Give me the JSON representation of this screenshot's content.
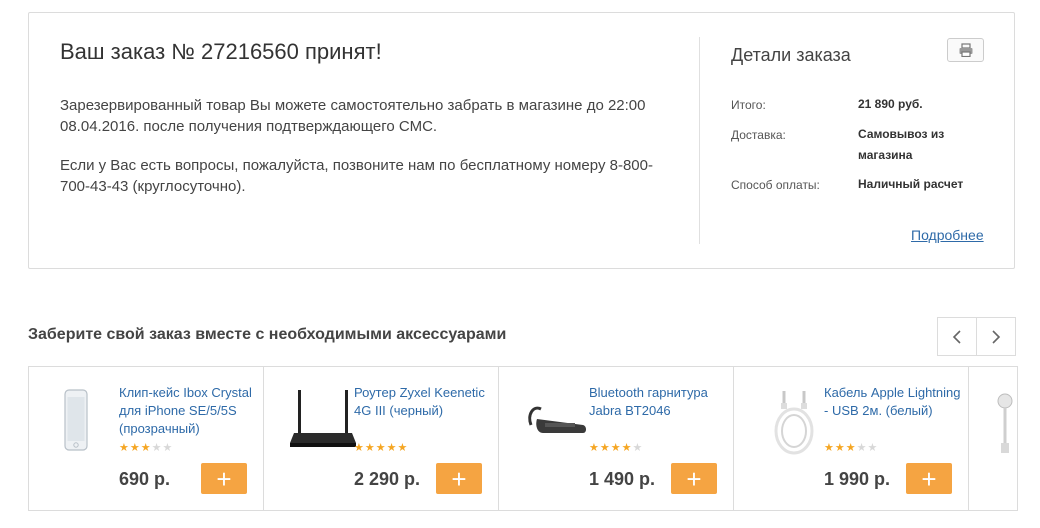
{
  "order": {
    "title": "Ваш заказ № 27216560 принят!",
    "message1": "Зарезервированный товар Вы можете самостоятельно забрать в магазине до 22:00 08.04.2016. после получения подтверждающего СМС.",
    "message2": "Если у Вас есть вопросы, пожалуйста, позвоните нам по бесплатному номеру 8-800-700-43-43 (круглосуточно)."
  },
  "details": {
    "title": "Детали заказа",
    "print_icon": "printer-icon",
    "total_label": "Итого:",
    "total_value": "21 890 руб.",
    "delivery_label": "Доставка:",
    "delivery_value": "Самовывоз из магазина",
    "payment_label": "Способ оплаты:",
    "payment_value": "Наличный расчет",
    "more_link": "Подробнее"
  },
  "accessories": {
    "title": "Заберите свой заказ вместе с необходимыми аксессуарами",
    "prev_icon": "chevron-left-icon",
    "next_icon": "chevron-right-icon",
    "add_label": "+",
    "products": [
      {
        "name": "Клип-кейс Ibox Crystal для iPhone SE/5/5S (прозрачный)",
        "rating": 2.5,
        "price": "690 р.",
        "image": "phone-case-image"
      },
      {
        "name": "Роутер Zyxel Keenetic 4G III (черный)",
        "rating": 5,
        "price": "2 290 р.",
        "image": "router-image"
      },
      {
        "name": "Bluetooth гарнитура Jabra BT2046",
        "rating": 4.5,
        "price": "1 490 р.",
        "image": "headset-image"
      },
      {
        "name": "Кабель Apple Lightning - USB 2м. (белый)",
        "rating": 3.5,
        "price": "1 990 р.",
        "image": "cable-image"
      }
    ],
    "accent_color": "#f5a442"
  }
}
